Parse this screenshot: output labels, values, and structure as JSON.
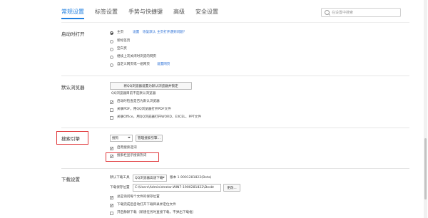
{
  "tabs": [
    {
      "label": "常规设置",
      "active": true
    },
    {
      "label": "标签设置",
      "active": false
    },
    {
      "label": "手势与快捷键",
      "active": false
    },
    {
      "label": "高级",
      "active": false
    },
    {
      "label": "安全设置",
      "active": false
    }
  ],
  "search": {
    "placeholder": "在设置中搜索"
  },
  "startup": {
    "title": "启动时打开",
    "home_label": "主页",
    "set_link": "设置",
    "default_link": "恢复默认",
    "question_link": "主页打开遇到问题？",
    "options": [
      "新标签页",
      "空白页",
      "继续上次关闭时浏览的网页",
      "自定义网页或一组网页"
    ],
    "set_pages_link": "设置网页"
  },
  "default_browser": {
    "title": "默认浏览器",
    "set_button": "将QQ浏览器设置为默认浏览器并锁定",
    "status_text": "QQ浏览器目前不是默认浏览器",
    "checkbox_1": "启动时检查是否为默认浏览器",
    "checkbox_2": "关联PDF，用QQ浏览器打开PDF文件",
    "checkbox_3": "关联Office，用QQ浏览器打开WORD、EXCEL、PPT文件"
  },
  "search_engine": {
    "title": "搜索引擎",
    "engine_value": "搜狗",
    "manage_button": "管理搜索引擎...",
    "checkbox_1": "启用搜索选词",
    "checkbox_2": "搜索栏显示搜索热词"
  },
  "download": {
    "title": "下载设置",
    "default_tool_label": "默认下载工具",
    "default_tool_value": "QQ浏览器高速下载",
    "version": "版本 1.9001281822(Beta)",
    "save_location_label": "下载保存位置",
    "save_path": "C:\\Users\\Administrator.WIN7-1900281822\\Deskt",
    "change_button": "更改...",
    "checkbox_1": "总是询问每个文件的保存位置",
    "checkbox_2": "下载完成后自动打开下载目录并定位文件",
    "checkbox_3": "开启静默下载（新建任务时直接下载，不弹出下载框）"
  }
}
